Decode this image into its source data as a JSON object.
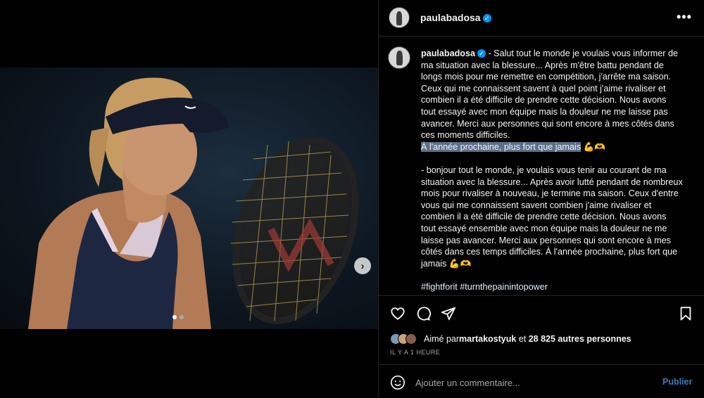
{
  "post": {
    "username": "paulabadosa",
    "verified_mark": "✓"
  },
  "media": {
    "next_glyph": "›",
    "slide_count": 2,
    "active_slide": 1
  },
  "caption": {
    "username": "paulabadosa",
    "paragraph1": " - Salut tout le monde je voulais vous informer de ma situation avec la blessure... Après m'être battu pendant de longs mois pour me remettre en compétition, j'arrête ma saison. Ceux qui me connaissent savent à quel point j'aime rivaliser et combien il a été difficile de prendre cette décision. Nous avons tout essayé avec mon équipe mais la douleur ne me laisse pas avancer. Merci aux personnes qui sont encore à mes côtés dans ces moments difficiles.",
    "highlighted_line": "À l'année prochaine, plus fort que jamais",
    "highlighted_emoji": " 💪🫶",
    "paragraph2": "- bonjour tout le monde, je voulais vous tenir au courant de ma situation avec la blessure... Après avoir lutté pendant de nombreux mois pour rivaliser à nouveau, je termine ma saison. Ceux d'entre vous qui me connaissent savent combien j'aime rivaliser et combien il a été difficile de prendre cette décision. Nous avons tout essayé ensemble avec mon équipe mais la douleur ne me laisse pas avancer. Merci aux personnes qui sont encore à mes côtés dans ces temps difficiles. À l'année prochaine, plus fort que jamais 💪🫶",
    "hashtags": "#fightforit #turnthepainintopower"
  },
  "engagement": {
    "liked_prefix": "Aimé par ",
    "liked_user": "martakostyuk",
    "liked_joiner": " et ",
    "liked_others": "28 825 autres personnes",
    "time": "IL Y A 1 HEURE"
  },
  "comment": {
    "placeholder": "Ajouter un commentaire...",
    "publish_label": "Publier"
  },
  "icons": {
    "like": "heart-icon",
    "comment": "comment-icon",
    "share": "share-icon",
    "save": "bookmark-icon",
    "more": "more-options-icon",
    "emoji": "emoji-icon"
  },
  "colors": {
    "background": "#000000",
    "text": "#f5f5f5",
    "secondary_text": "#a8a8a8",
    "verified": "#0095f6",
    "publish": "#3e7ab8",
    "highlight": "#5c6f8a",
    "divider": "#262626"
  }
}
